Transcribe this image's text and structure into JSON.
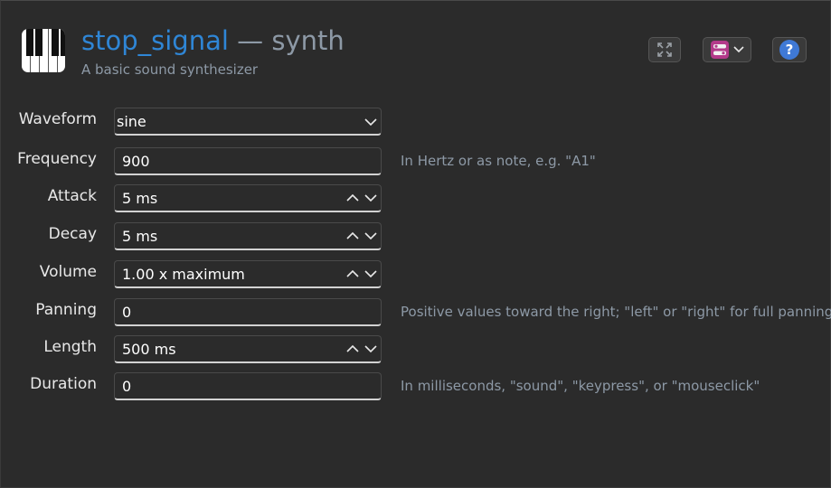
{
  "header": {
    "name": "stop_signal",
    "dash": "—",
    "type": "synth",
    "description": "A basic sound synthesizer"
  },
  "toolbar": {
    "fullscreen_icon": "expand-arrows-icon",
    "view_icon": "toggle-view-icon",
    "help_label": "?"
  },
  "fields": {
    "waveform": {
      "label": "Waveform",
      "value": "sine"
    },
    "frequency": {
      "label": "Frequency",
      "value": "900",
      "hint": "In Hertz or as note, e.g. \"A1\""
    },
    "attack": {
      "label": "Attack",
      "value": "5 ms"
    },
    "decay": {
      "label": "Decay",
      "value": "5 ms"
    },
    "volume": {
      "label": "Volume",
      "value": "1.00 x maximum"
    },
    "panning": {
      "label": "Panning",
      "value": "0",
      "hint": "Positive values toward the right; \"left\" or \"right\" for full panning"
    },
    "length": {
      "label": "Length",
      "value": "500 ms"
    },
    "duration": {
      "label": "Duration",
      "value": "0",
      "hint": "In milliseconds, \"sound\", \"keypress\", or \"mouseclick\""
    }
  },
  "colors": {
    "accent": "#2f86d6",
    "muted": "#8d99a6",
    "background": "#2b2b2b"
  }
}
